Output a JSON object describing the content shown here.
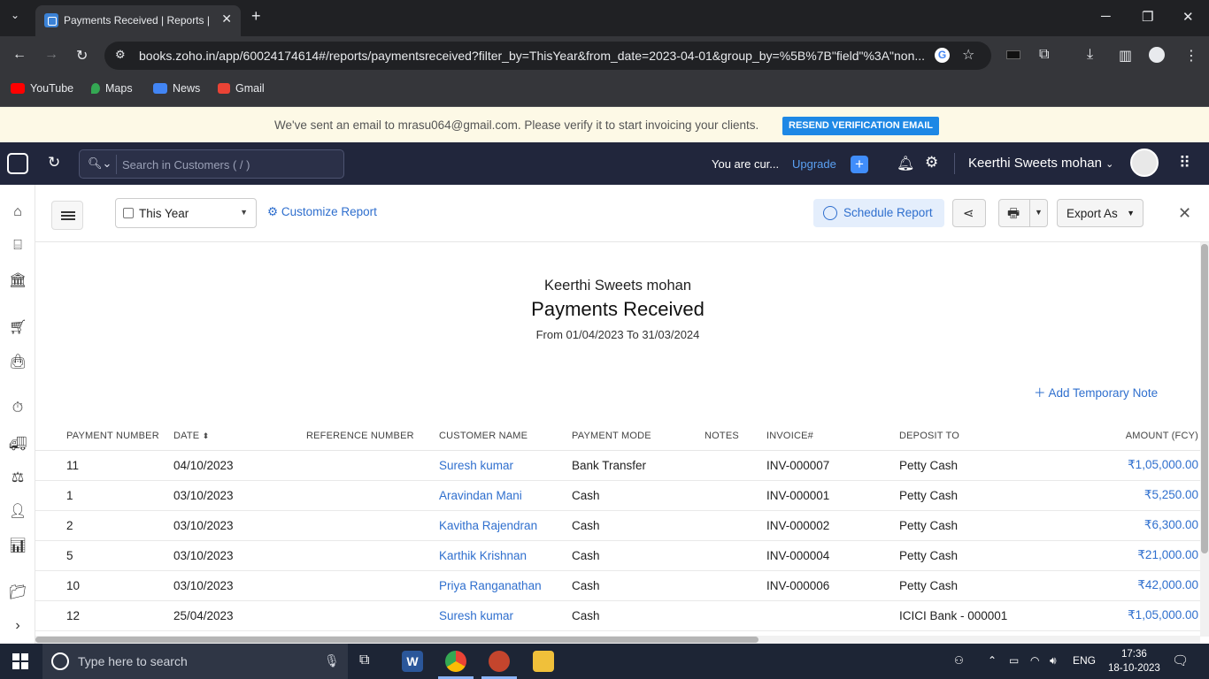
{
  "browser": {
    "tab_title": "Payments Received | Reports |",
    "url": "books.zoho.in/app/60024174614#/reports/paymentsreceived?filter_by=ThisYear&from_date=2023-04-01&group_by=%5B%7B\"field\"%3A\"non...",
    "bookmarks": [
      "YouTube",
      "Maps",
      "News",
      "Gmail"
    ]
  },
  "banner": {
    "message": "We've sent an email to mrasu064@gmail.com. Please verify it to start invoicing your clients.",
    "button": "RESEND VERIFICATION EMAIL"
  },
  "header": {
    "search_placeholder": "Search in Customers ( / )",
    "trial_text": "You are cur...",
    "upgrade": "Upgrade",
    "org_name": "Keerthi Sweets mohan"
  },
  "toolbar": {
    "period": "This Year",
    "customize": "Customize Report",
    "schedule": "Schedule Report",
    "export": "Export As"
  },
  "report": {
    "org": "Keerthi Sweets mohan",
    "title": "Payments Received",
    "range": "From 01/04/2023 To 31/03/2024",
    "add_note": "Add Temporary Note",
    "columns": [
      "PAYMENT NUMBER",
      "DATE",
      "REFERENCE NUMBER",
      "CUSTOMER NAME",
      "PAYMENT MODE",
      "NOTES",
      "INVOICE#",
      "DEPOSIT TO",
      "AMOUNT (FCY)"
    ],
    "rows": [
      {
        "number": "11",
        "date": "04/10/2023",
        "reference": "",
        "customer": "Suresh kumar",
        "mode": "Bank Transfer",
        "notes": "",
        "invoice": "INV-000007",
        "deposit": "Petty Cash",
        "amount": "₹1,05,000.00"
      },
      {
        "number": "1",
        "date": "03/10/2023",
        "reference": "",
        "customer": "Aravindan Mani",
        "mode": "Cash",
        "notes": "",
        "invoice": "INV-000001",
        "deposit": "Petty Cash",
        "amount": "₹5,250.00"
      },
      {
        "number": "2",
        "date": "03/10/2023",
        "reference": "",
        "customer": "Kavitha Rajendran",
        "mode": "Cash",
        "notes": "",
        "invoice": "INV-000002",
        "deposit": "Petty Cash",
        "amount": "₹6,300.00"
      },
      {
        "number": "5",
        "date": "03/10/2023",
        "reference": "",
        "customer": "Karthik Krishnan",
        "mode": "Cash",
        "notes": "",
        "invoice": "INV-000004",
        "deposit": "Petty Cash",
        "amount": "₹21,000.00"
      },
      {
        "number": "10",
        "date": "03/10/2023",
        "reference": "",
        "customer": "Priya Ranganathan",
        "mode": "Cash",
        "notes": "",
        "invoice": "INV-000006",
        "deposit": "Petty Cash",
        "amount": "₹42,000.00"
      },
      {
        "number": "12",
        "date": "25/04/2023",
        "reference": "",
        "customer": "Suresh kumar",
        "mode": "Cash",
        "notes": "",
        "invoice": "",
        "deposit": "ICICI Bank - 000001",
        "amount": "₹1,05,000.00"
      }
    ]
  },
  "taskbar": {
    "search_placeholder": "Type here to search",
    "lang": "ENG",
    "time": "17:36",
    "date": "18-10-2023"
  },
  "colors": {
    "accent": "#2f6fce",
    "header_bg": "#21263c",
    "banner_bg": "#fdf9e6"
  }
}
